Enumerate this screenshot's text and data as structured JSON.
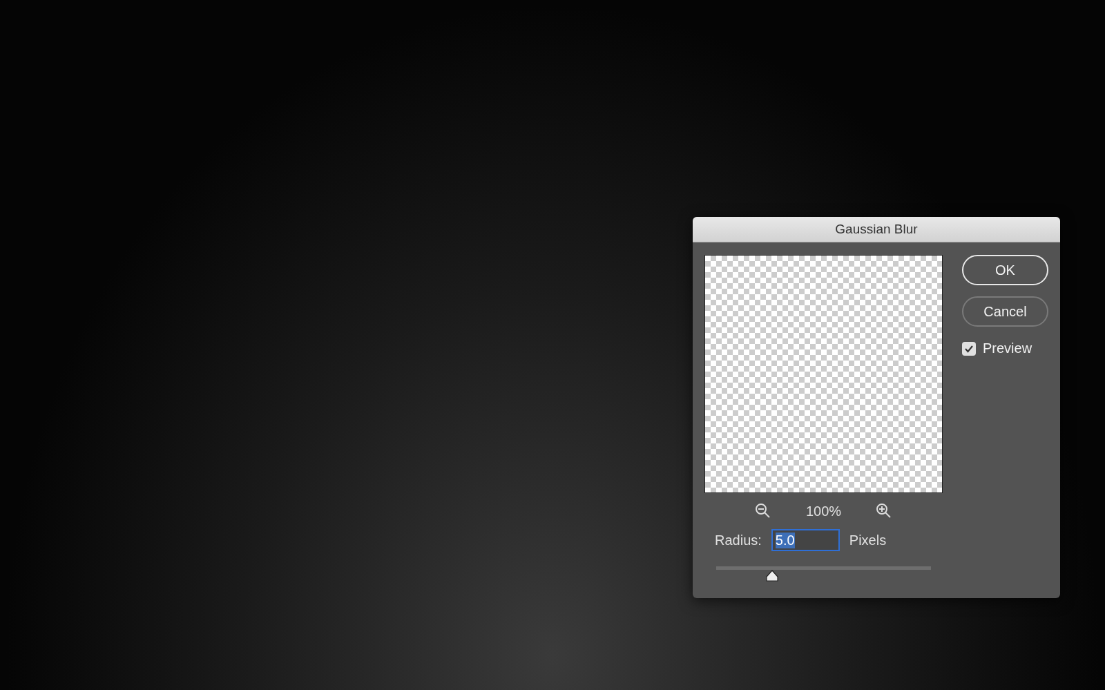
{
  "dialog": {
    "title": "Gaussian Blur",
    "zoom": {
      "value": "100%"
    },
    "radius": {
      "label": "Radius:",
      "value": "5.0",
      "unit": "Pixels",
      "level": 0.26
    },
    "buttons": [
      {
        "label": "OK",
        "kind": "default"
      },
      {
        "label": "Cancel",
        "kind": "normal"
      }
    ],
    "preview": {
      "label": "Preview",
      "checked": true
    }
  }
}
